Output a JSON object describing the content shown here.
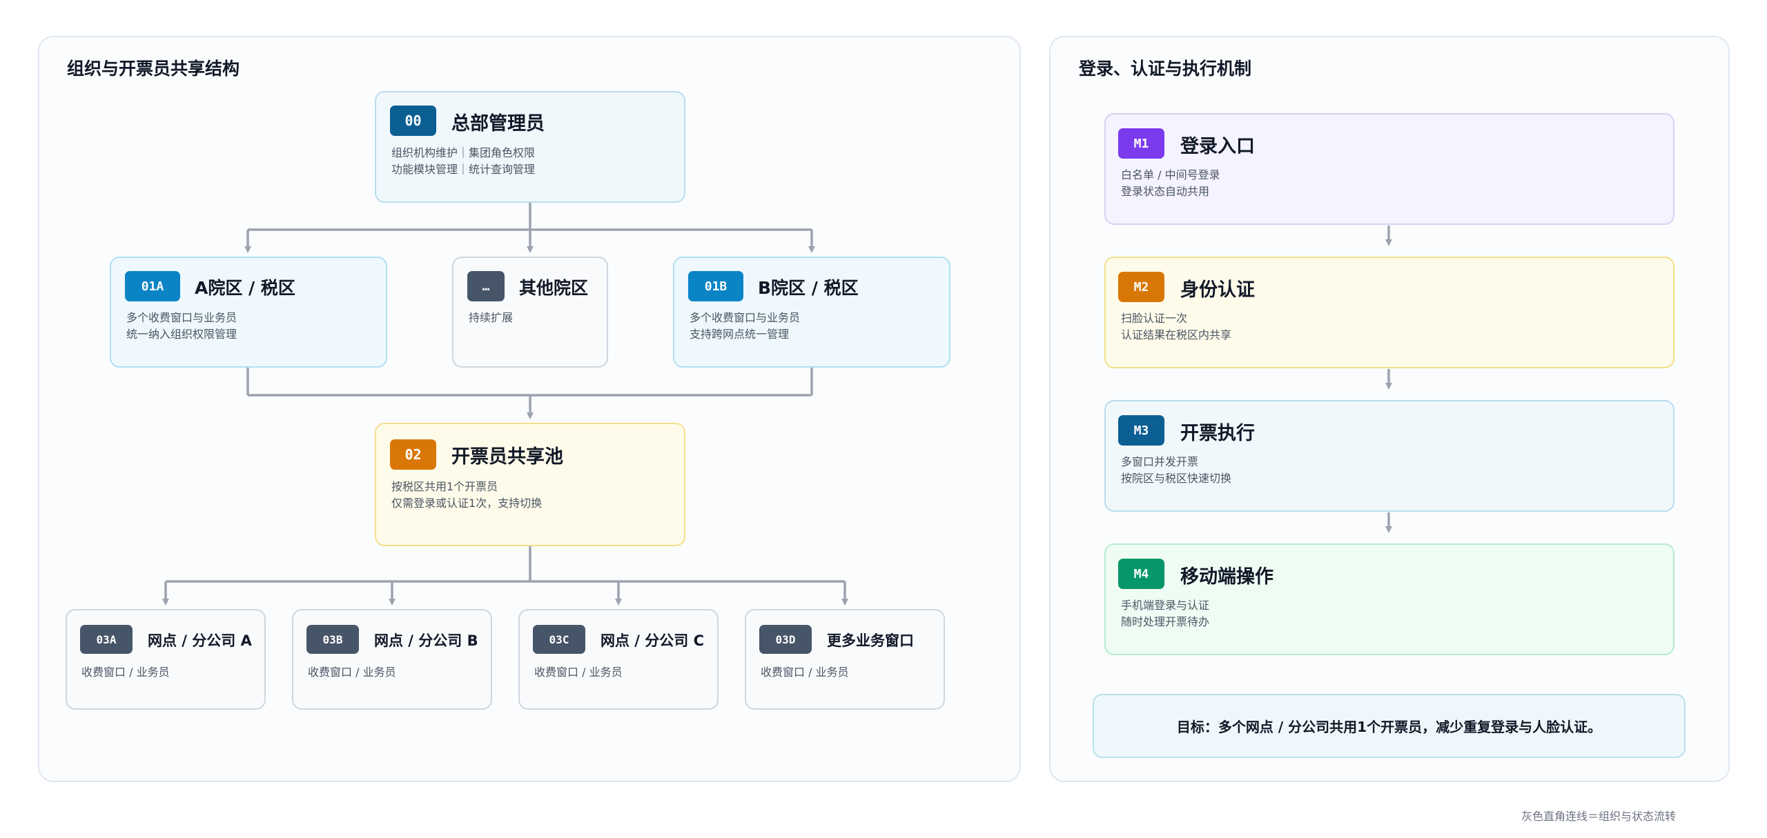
{
  "left_panel": {
    "title": "组织与开票员共享结构",
    "hq": {
      "badge": "00",
      "title": "总部管理员",
      "desc": [
        "组织机构维护｜集团角色权限",
        "功能模块管理｜统计查询管理"
      ]
    },
    "zones": [
      {
        "badge": "01A",
        "title": "A院区 / 税区",
        "desc": [
          "多个收费窗口与业务员",
          "统一纳入组织权限管理"
        ]
      },
      {
        "badge": "…",
        "title": "其他院区",
        "desc": [
          "持续扩展"
        ]
      },
      {
        "badge": "01B",
        "title": "B院区 / 税区",
        "desc": [
          "多个收费窗口与业务员",
          "支持跨网点统一管理"
        ]
      }
    ],
    "pool": {
      "badge": "02",
      "title": "开票员共享池",
      "desc": [
        "按税区共用1个开票员",
        "仅需登录或认证1次，支持切换"
      ]
    },
    "branches": [
      {
        "badge": "03A",
        "title": "网点 / 分公司 A",
        "desc": "收费窗口 / 业务员"
      },
      {
        "badge": "03B",
        "title": "网点 / 分公司 B",
        "desc": "收费窗口 / 业务员"
      },
      {
        "badge": "03C",
        "title": "网点 / 分公司 C",
        "desc": "收费窗口 / 业务员"
      },
      {
        "badge": "03D",
        "title": "更多业务窗口",
        "desc": "收费窗口 / 业务员"
      }
    ]
  },
  "right_panel": {
    "title": "登录、认证与执行机制",
    "steps": [
      {
        "badge": "M1",
        "title": "登录入口",
        "desc": [
          "白名单 / 中间号登录",
          "登录状态自动共用"
        ]
      },
      {
        "badge": "M2",
        "title": "身份认证",
        "desc": [
          "扫脸认证一次",
          "认证结果在税区内共享"
        ]
      },
      {
        "badge": "M3",
        "title": "开票执行",
        "desc": [
          "多窗口并发开票",
          "按院区与税区快速切换"
        ]
      },
      {
        "badge": "M4",
        "title": "移动端操作",
        "desc": [
          "手机端登录与认证",
          "随时处理开票待办"
        ]
      }
    ],
    "goal": "目标：多个网点 / 分公司共用1个开票员，减少重复登录与人脸认证。"
  },
  "legend": "灰色直角连线＝组织与状态流转",
  "colors": {
    "badge_blue_dark": "#0b5f93",
    "badge_blue": "#0b84c6",
    "badge_slate": "#475569",
    "badge_orange": "#d97706",
    "badge_purple": "#7c3aed",
    "badge_green": "#059669",
    "connector": "#9ca3af"
  }
}
